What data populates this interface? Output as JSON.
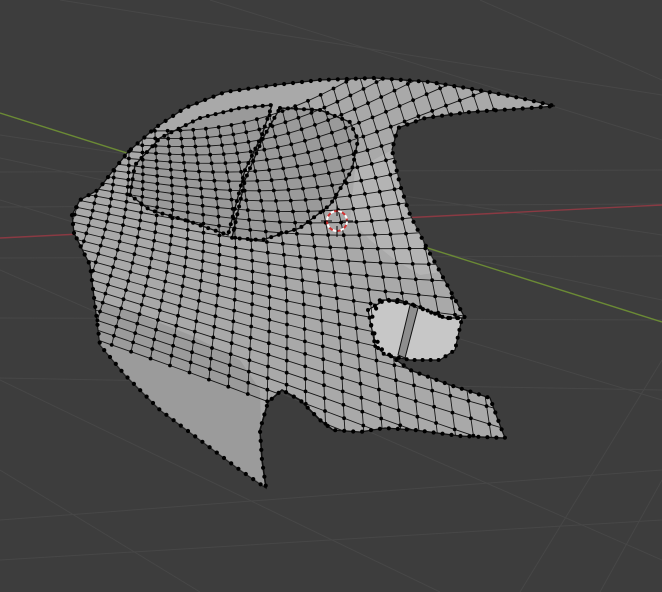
{
  "viewport": {
    "mode": "edit-mode",
    "object": "car-body-rear-quarter-mesh",
    "show_grid_floor": true,
    "show_x_axis": true,
    "show_y_axis": true,
    "show_3d_cursor": true,
    "show_vertices": true,
    "icons": [
      "3d-cursor-icon"
    ]
  },
  "colors": {
    "background": "#3d3d3d",
    "grid_line": "#474747",
    "x_axis": "#8a3a43",
    "y_axis": "#6b8a35",
    "mesh_face": "#a9a9a9",
    "mesh_face_dark": "#8f8f8f",
    "mesh_face_light": "#bdbdbd",
    "window_face": "#9a9a9a",
    "edge": "#111111",
    "vertex": "#000000",
    "cursor_red": "#d23030",
    "cursor_white": "#ffffff"
  }
}
